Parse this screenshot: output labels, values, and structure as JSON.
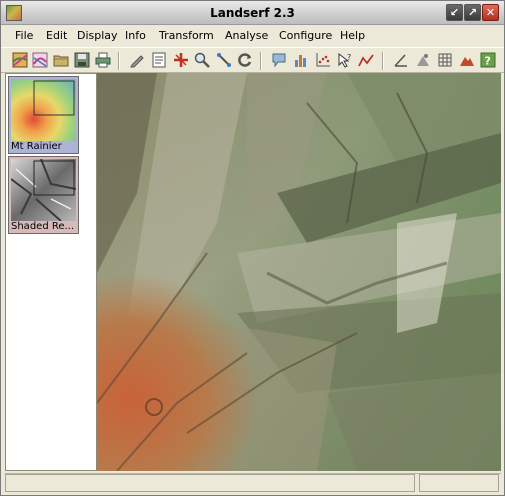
{
  "window": {
    "title": "Landserf 2.3",
    "minimize_icon": "arrow-down-left-icon",
    "maximize_icon": "arrow-up-right-icon",
    "close_icon": "close-icon"
  },
  "menubar": {
    "items": [
      {
        "label": "File"
      },
      {
        "label": "Edit"
      },
      {
        "label": "Display"
      },
      {
        "label": "Info"
      },
      {
        "label": "Transform"
      },
      {
        "label": "Analyse"
      },
      {
        "label": "Configure"
      },
      {
        "label": "Help"
      }
    ]
  },
  "toolbar": {
    "icons": [
      "new-raster-icon",
      "new-vector-icon",
      "open-folder-icon",
      "save-icon",
      "print-icon",
      "pencil-icon",
      "text-edit-icon",
      "cross-marker-icon",
      "zoom-icon",
      "pan-icon",
      "refresh-icon",
      "speech-bubble-icon",
      "bar-chart-icon",
      "scatter-plot-icon",
      "query-cursor-icon",
      "line-graph-icon",
      "angle-icon",
      "points-icon",
      "grid-icon",
      "mountain-icon",
      "help-icon"
    ]
  },
  "layers": [
    {
      "label": "Mt Rainier",
      "selected": true
    },
    {
      "label": "Shaded Re...",
      "selected": false
    }
  ],
  "status": {
    "left_text": "",
    "right_text": ""
  },
  "colors": {
    "titlebar": "#d4d4d4",
    "selected_layer_bg": "#aeb3d6",
    "secondary_layer_bg": "#d7b9b9",
    "close_button": "#c8402c"
  }
}
